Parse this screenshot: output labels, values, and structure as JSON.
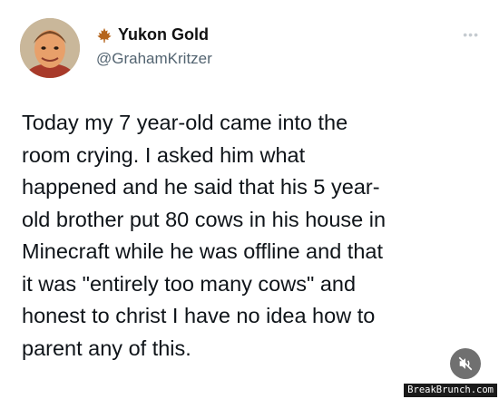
{
  "tweet": {
    "author": {
      "display_name": "Yukon Gold",
      "handle": "@GrahamKritzer",
      "name_icon": "maple-leaf-icon"
    },
    "more_icon": "more-dots-icon",
    "text_lines": [
      "Today my 7 year-old came into the",
      "room crying. I asked him what",
      "happened and he said that his 5 year-",
      "old brother put 80 cows in his house in",
      "Minecraft while he was offline and that",
      "it was \"entirely too many cows\" and",
      "honest to christ I have no idea how to",
      "parent any of this."
    ]
  },
  "video_controls": {
    "mute_icon": "speaker-muted-icon"
  },
  "watermark": {
    "text": "BreakBrunch.com"
  },
  "colors": {
    "text": "#0f1419",
    "secondary": "#536471",
    "leaf": "#b5651d"
  }
}
